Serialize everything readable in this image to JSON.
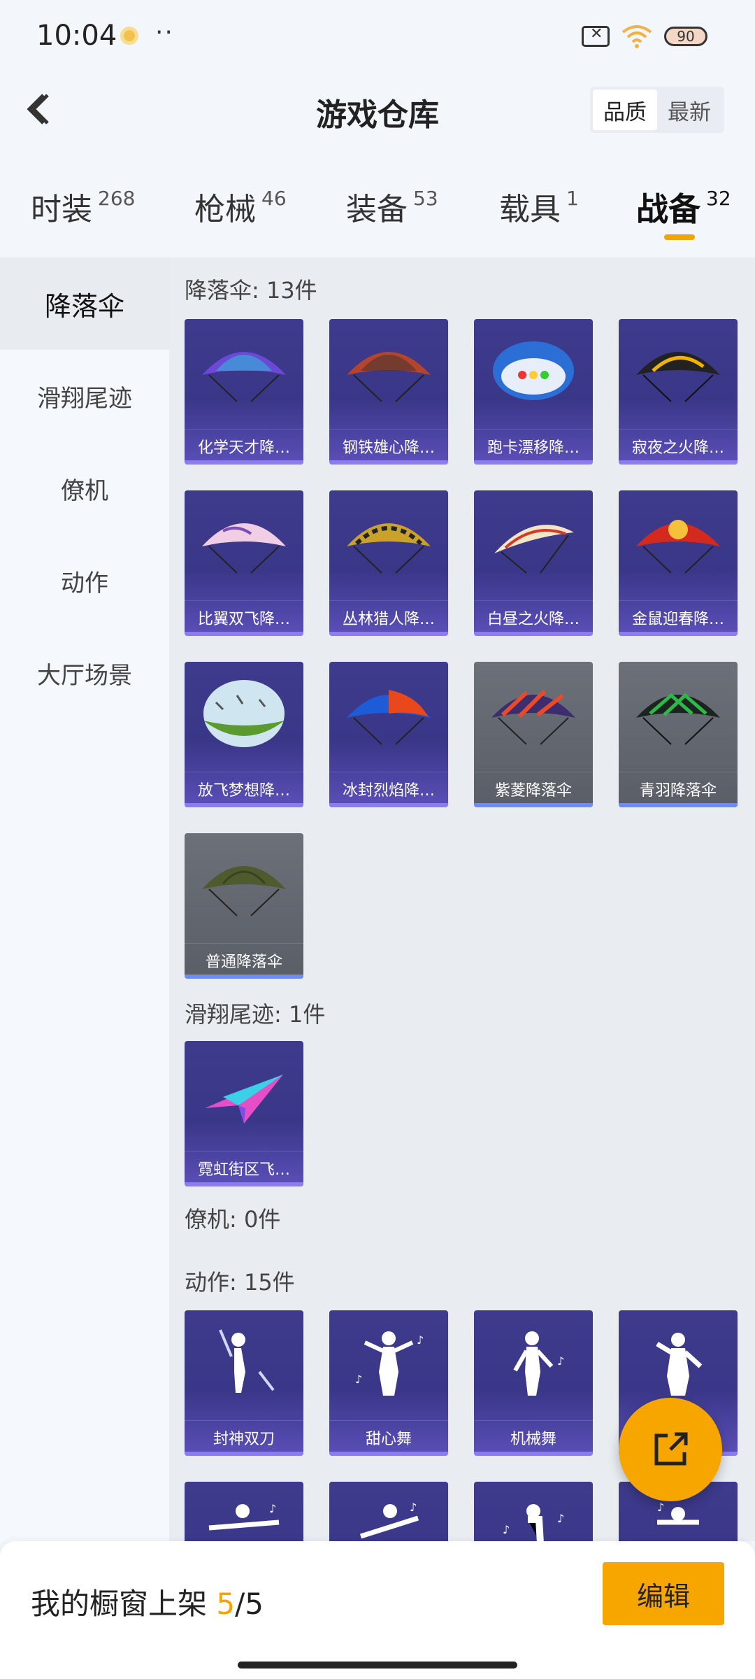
{
  "status": {
    "time": "10:04",
    "more": "··",
    "battery": "90"
  },
  "header": {
    "title": "游戏仓库",
    "sort_options": [
      "品质",
      "最新"
    ],
    "sort_active": "品质"
  },
  "tabs": [
    {
      "label": "时装",
      "count": "268"
    },
    {
      "label": "枪械",
      "count": "46"
    },
    {
      "label": "装备",
      "count": "53"
    },
    {
      "label": "载具",
      "count": "1"
    },
    {
      "label": "战备",
      "count": "32",
      "active": true
    }
  ],
  "sidebar": {
    "items": [
      "降落伞",
      "滑翔尾迹",
      "僚机",
      "动作",
      "大厅场景"
    ],
    "active": "降落伞"
  },
  "sections": {
    "parachute": {
      "title": "降落伞: 13件",
      "items": [
        "化学天才降…",
        "钢铁雄心降…",
        "跑卡漂移降…",
        "寂夜之火降…",
        "比翼双飞降…",
        "丛林猎人降…",
        "白昼之火降…",
        "金鼠迎春降…",
        "放飞梦想降…",
        "冰封烈焰降…",
        "紫菱降落伞",
        "青羽降落伞",
        "普通降落伞"
      ]
    },
    "trail": {
      "title": "滑翔尾迹: 1件",
      "items": [
        "霓虹街区飞…"
      ]
    },
    "wingman": {
      "title": "僚机: 0件"
    },
    "emote": {
      "title": "动作: 15件",
      "items": [
        "封神双刀",
        "甜心舞",
        "机械舞"
      ]
    }
  },
  "bottom": {
    "shelf_label": "我的橱窗上架",
    "shelf_count": "5",
    "shelf_total": "/5",
    "edit": "编辑"
  },
  "colors": {
    "accent": "#f7a600",
    "card_purple": "#3e3a8c",
    "card_gray": "#62666f"
  }
}
